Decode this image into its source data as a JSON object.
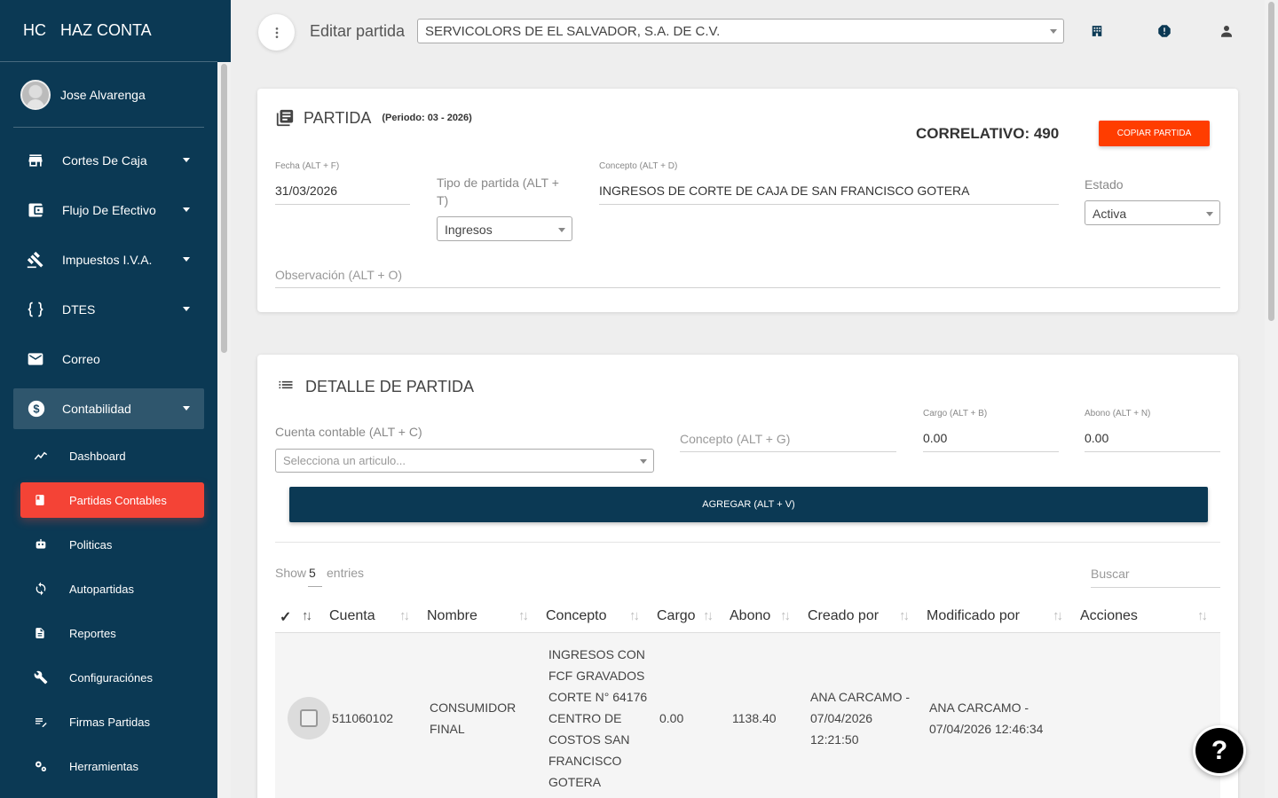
{
  "app": {
    "abbr": "HC",
    "name": "HAZ CONTA"
  },
  "user": {
    "name": "Jose Alvarenga"
  },
  "sidebar": {
    "items": [
      {
        "label": "Cortes De Caja",
        "icon": "store-icon"
      },
      {
        "label": "Flujo De Efectivo",
        "icon": "wallet-icon"
      },
      {
        "label": "Impuestos I.V.A.",
        "icon": "gavel-icon"
      },
      {
        "label": "DTES",
        "icon": "braces-icon"
      },
      {
        "label": "Correo",
        "icon": "mail-icon"
      },
      {
        "label": "Contabilidad",
        "icon": "dollar-icon"
      }
    ],
    "subitems": [
      {
        "label": "Dashboard",
        "icon": "chart-icon"
      },
      {
        "label": "Partidas Contables",
        "icon": "book-icon"
      },
      {
        "label": "Politicas",
        "icon": "robot-icon"
      },
      {
        "label": "Autopartidas",
        "icon": "refresh-icon"
      },
      {
        "label": "Reportes",
        "icon": "document-icon"
      },
      {
        "label": "Configuraciónes",
        "icon": "wrench-icon"
      },
      {
        "label": "Firmas Partidas",
        "icon": "edit-list-icon"
      },
      {
        "label": "Herramientas",
        "icon": "gears-icon"
      }
    ]
  },
  "topbar": {
    "title": "Editar partida",
    "company": "SERVICOLORS DE EL SALVADOR, S.A. DE C.V."
  },
  "partida": {
    "title": "PARTIDA",
    "periodo": "(Periodo: 03 - 2026)",
    "correlativo": "CORRELATIVO: 490",
    "copy_button": "COPIAR PARTIDA",
    "fecha_label": "Fecha (ALT + F)",
    "fecha_value": "31/03/2026",
    "tipo_label_1": "Tipo de partida (ALT +",
    "tipo_label_2": "T)",
    "tipo_value": "Ingresos",
    "concepto_label": "Concepto (ALT + D)",
    "concepto_value": "INGRESOS DE CORTE DE CAJA DE SAN FRANCISCO GOTERA",
    "estado_label": "Estado",
    "estado_value": "Activa",
    "observacion_placeholder": "Observación (ALT + O)"
  },
  "detalle": {
    "title": "DETALLE DE PARTIDA",
    "cuenta_label": "Cuenta contable (ALT + C)",
    "cuenta_placeholder": "Selecciona un articulo...",
    "concepto_placeholder": "Concepto (ALT + G)",
    "cargo_label": "Cargo (ALT + B)",
    "cargo_value": "0.00",
    "abono_label": "Abono (ALT + N)",
    "abono_value": "0.00",
    "add_button": "AGREGAR (ALT + V)",
    "show_label": "Show",
    "show_value": "5",
    "entries_label": "entries",
    "search_placeholder": "Buscar"
  },
  "table": {
    "columns": [
      "✓",
      "Cuenta",
      "Nombre",
      "Concepto",
      "Cargo",
      "Abono",
      "Creado por",
      "Modificado por",
      "Acciones"
    ],
    "rows": [
      {
        "cuenta": "511060102",
        "nombre": [
          "CONSUMIDOR",
          "FINAL"
        ],
        "concepto": [
          "INGRESOS CON",
          "FCF GRAVADOS",
          "CORTE N° 64176",
          "CENTRO DE",
          "COSTOS SAN",
          "FRANCISCO",
          "GOTERA"
        ],
        "cargo": "0.00",
        "abono": "1138.40",
        "creado": [
          "ANA CARCAMO -",
          "07/04/2026",
          "12:21:50"
        ],
        "modificado": [
          "ANA CARCAMO -",
          "07/04/2026 12:46:34"
        ]
      }
    ]
  },
  "help": {
    "label": "?"
  },
  "colors": {
    "sidebar": "#0b3954",
    "accent": "#f44336",
    "copy_button": "#ff3d00"
  }
}
